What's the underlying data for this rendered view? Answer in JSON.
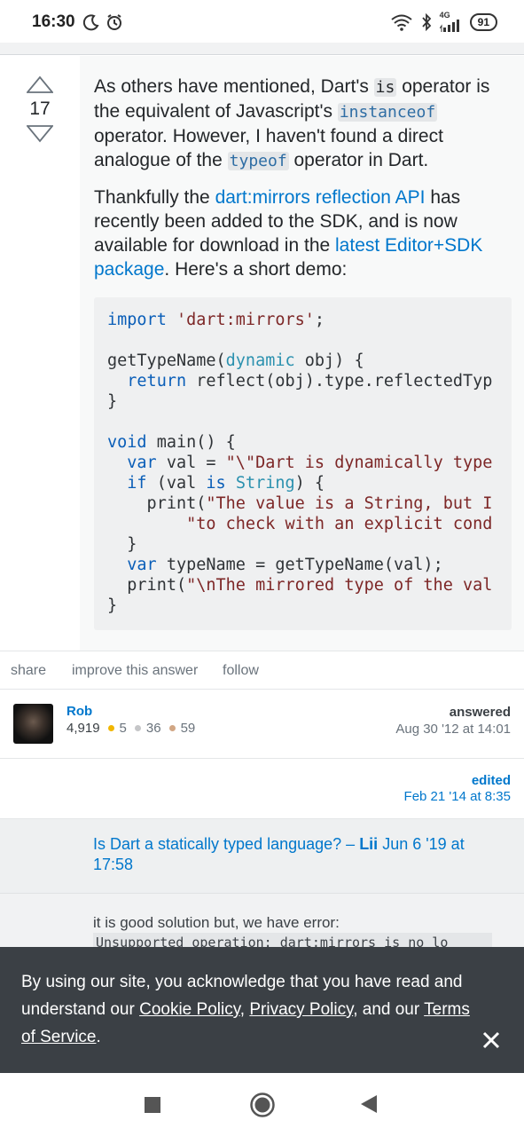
{
  "status_bar": {
    "time": "16:30",
    "network": "4G",
    "battery": "91"
  },
  "answer": {
    "vote_count": "17",
    "p1_part1": "As others have mentioned, Dart's ",
    "p1_code1": "is",
    "p1_part2": " operator is the equivalent of Javascript's ",
    "p1_code2": "instanceof",
    "p1_part3": " operator. However, I haven't found a direct analogue of the ",
    "p1_code3": "typeof",
    "p1_part4": " operator in Dart.",
    "p2_part1": "Thankfully the ",
    "p2_link1": "dart:mirrors reflection API",
    "p2_part2": " has recently been added to the SDK, and is now available for download in the ",
    "p2_link2": "latest Editor+SDK package",
    "p2_part3": ". Here's a short demo:",
    "code_lines": [
      "import 'dart:mirrors';",
      "",
      "getTypeName(dynamic obj) {",
      "  return reflect(obj).type.reflectedTyp",
      "}",
      "",
      "void main() {",
      "  var val = \"\\\"Dart is dynamically type",
      "  if (val is String) {",
      "    print(\"The value is a String, but I",
      "        \"to check with an explicit cond",
      "  }",
      "  var typeName = getTypeName(val);",
      "  print(\"\\nThe mirrored type of the val",
      "}"
    ]
  },
  "post_menu": {
    "share": "share",
    "improve": "improve this answer",
    "follow": "follow"
  },
  "user": {
    "name": "Rob",
    "reputation": "4,919",
    "gold": "5",
    "silver": "36",
    "bronze": "59",
    "answered_label": "answered",
    "answered_date": "Aug 30 '12 at 14:01"
  },
  "edit": {
    "label": "edited",
    "date": "Feb 21 '14 at 8:35"
  },
  "comments": {
    "c1_text": "Is Dart a statically typed language? – ",
    "c1_author": "Lii",
    "c1_date": " Jun 6 '19 at 17:58",
    "c2_text": "it is good solution but, we have error:",
    "c2_code": "Unsupported operation: dart:mirrors is no lo"
  },
  "cookie": {
    "text1": "By using our site, you acknowledge that you have read and understand our ",
    "cookie_policy": "Cookie Policy",
    "sep": ", ",
    "privacy_policy": "Privacy Policy",
    "text2": ", and our ",
    "terms": "Terms of Service",
    "text3": "."
  },
  "colors": {
    "link": "#0077cc",
    "banner_bg": "#3b4045",
    "code_bg": "#eff0f1",
    "gold_badge": "#f1b600",
    "silver_badge": "#c5c6c8",
    "bronze_badge": "#d1a684"
  }
}
